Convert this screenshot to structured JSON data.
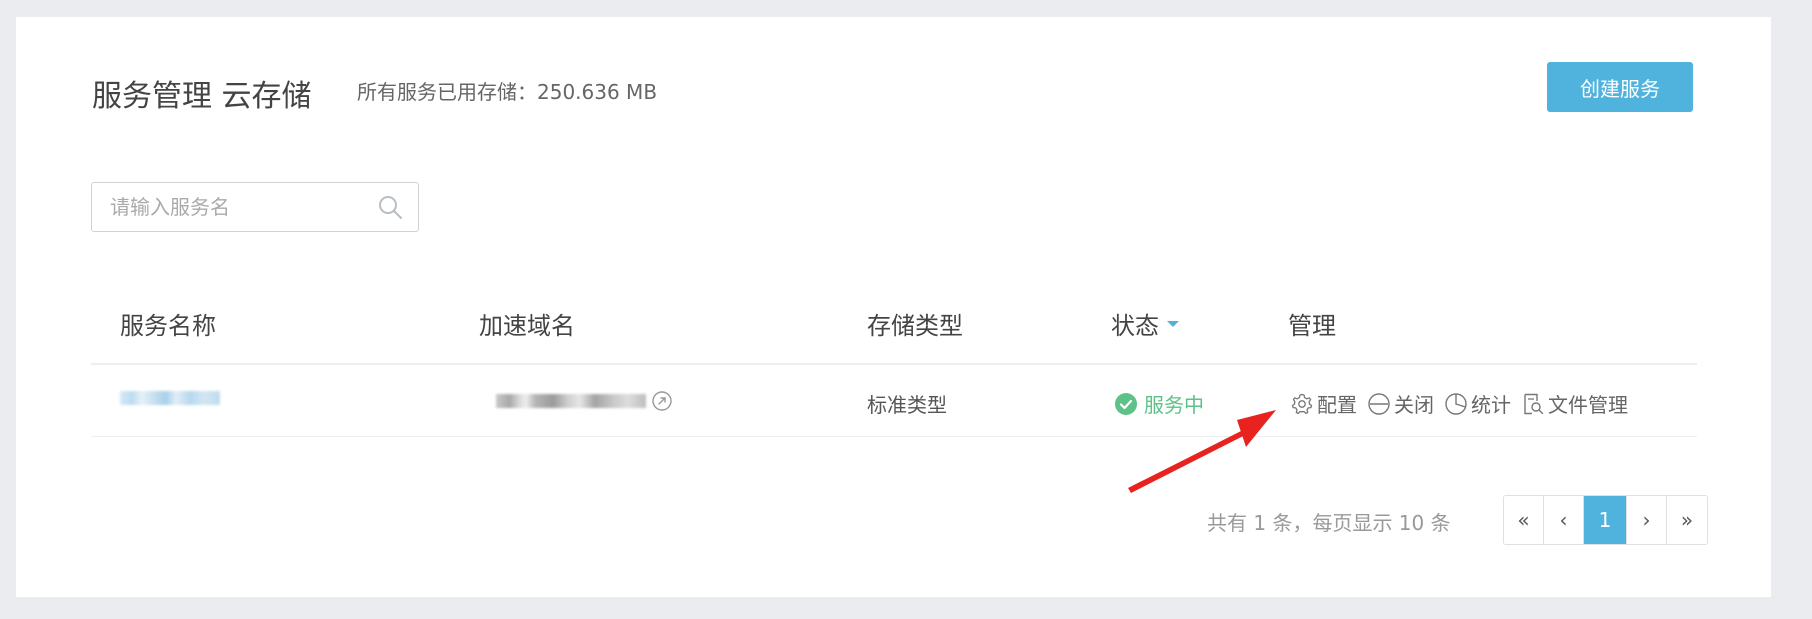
{
  "header": {
    "title": "服务管理 云存储",
    "storage_summary": "所有服务已用存储：250.636 MB",
    "create_button": "创建服务"
  },
  "search": {
    "placeholder": "请输入服务名",
    "value": "",
    "icon": "search-icon"
  },
  "table": {
    "columns": [
      "服务名称",
      "加速域名",
      "存储类型",
      "状态",
      "管理"
    ],
    "rows": [
      {
        "storage_type": "标准类型",
        "status": "服务中",
        "actions": [
          "配置",
          "关闭",
          "统计",
          "文件管理"
        ]
      }
    ]
  },
  "pagination": {
    "info": "共有 1 条，每页显示 10 条",
    "first": "«",
    "prev": "‹",
    "current": "1",
    "next": "›",
    "last": "»"
  },
  "colors": {
    "accent": "#4fb3de",
    "status_ok": "#5cc287",
    "annotation": "#e8231f",
    "background": "#eaecef"
  }
}
